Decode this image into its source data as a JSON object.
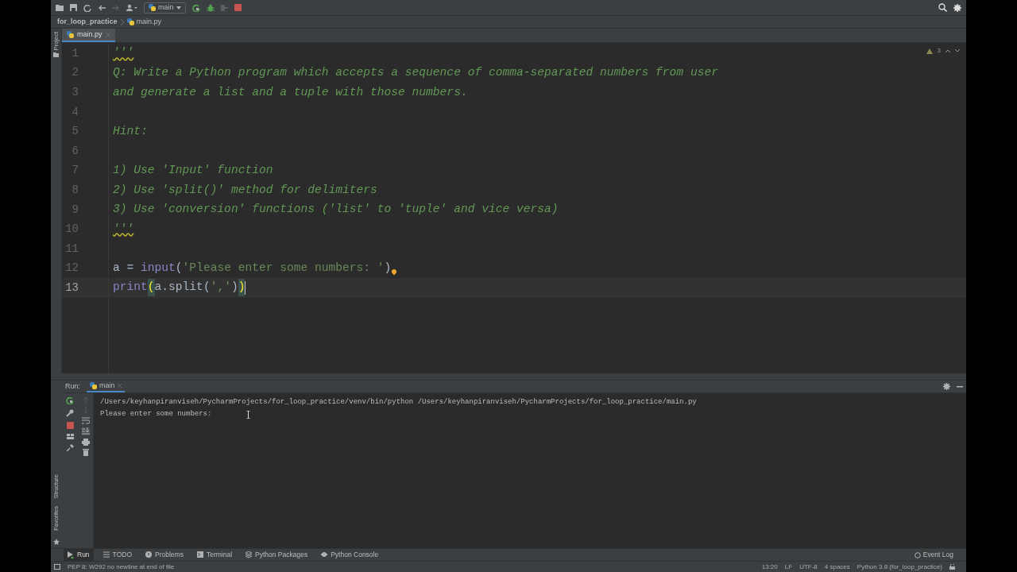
{
  "toolbar": {
    "run_config": "main"
  },
  "breadcrumb": [
    "for_loop_practice",
    "main.py"
  ],
  "left_strip": [
    "Project"
  ],
  "editor_tabs": [
    {
      "label": "main.py",
      "selected": true
    }
  ],
  "editor": {
    "warning_count": "3",
    "lines": [
      {
        "number": "1",
        "current": false,
        "bulb": false,
        "tokens": [
          {
            "text": "'''",
            "kind": "doc_quote"
          }
        ]
      },
      {
        "number": "2",
        "current": false,
        "bulb": false,
        "tokens": [
          {
            "text": "Q: Write a Python program which accepts a sequence of comma-separated numbers from user",
            "kind": "doc"
          }
        ]
      },
      {
        "number": "3",
        "current": false,
        "bulb": false,
        "tokens": [
          {
            "text": "and generate a list and a tuple with those numbers.",
            "kind": "doc"
          }
        ]
      },
      {
        "number": "4",
        "current": false,
        "bulb": false
      },
      {
        "number": "5",
        "current": false,
        "bulb": false,
        "tokens": [
          {
            "text": "Hint:",
            "kind": "doc"
          }
        ]
      },
      {
        "number": "6",
        "current": false,
        "bulb": false
      },
      {
        "number": "7",
        "current": false,
        "bulb": false,
        "tokens": [
          {
            "text": "1) Use 'Input' function",
            "kind": "doc"
          }
        ]
      },
      {
        "number": "8",
        "current": false,
        "bulb": false,
        "tokens": [
          {
            "text": "2) Use 'split()' method for delimiters",
            "kind": "doc"
          }
        ]
      },
      {
        "number": "9",
        "current": false,
        "bulb": false,
        "tokens": [
          {
            "text": "3) Use 'conversion' functions ('list' to 'tuple' and vice versa)",
            "kind": "doc"
          }
        ]
      },
      {
        "number": "10",
        "current": false,
        "bulb": false,
        "tokens": [
          {
            "text": "'''",
            "kind": "doc_quote"
          }
        ]
      },
      {
        "number": "11",
        "current": false,
        "bulb": false
      },
      {
        "number": "12",
        "current": false,
        "bulb": true,
        "tokens": [
          {
            "text": "a",
            "kind": "ident"
          },
          {
            "text": " = ",
            "kind": "ident"
          },
          {
            "text": "input",
            "kind": "builtin"
          },
          {
            "text": "(",
            "kind": "punct"
          },
          {
            "text": "'Please enter some numbers: '",
            "kind": "string"
          },
          {
            "text": ")",
            "kind": "punct"
          }
        ]
      },
      {
        "number": "13",
        "current": true,
        "bulb": false,
        "tokens": [
          {
            "text": "print",
            "kind": "builtin"
          },
          {
            "text": "(",
            "kind": "brace_match"
          },
          {
            "text": "a.split",
            "kind": "ident"
          },
          {
            "text": "(",
            "kind": "punct"
          },
          {
            "text": "','",
            "kind": "string"
          },
          {
            "text": ")",
            "kind": "punct"
          },
          {
            "text": ")",
            "kind": "brace_match"
          }
        ]
      }
    ]
  },
  "run_panel": {
    "label": "Run:",
    "tab": "main",
    "output": [
      "/Users/keyhanpiranviseh/PycharmProjects/for_loop_practice/venv/bin/python /Users/keyhanpiranviseh/PycharmProjects/for_loop_practice/main.py",
      "Please enter some numbers:"
    ]
  },
  "side_labels": [
    "Structure",
    "Favorites"
  ],
  "tool_tabs": [
    {
      "label": "Run",
      "selected": true
    },
    {
      "label": "TODO",
      "selected": false
    },
    {
      "label": "Problems",
      "selected": false
    },
    {
      "label": "Terminal",
      "selected": false
    },
    {
      "label": "Python Packages",
      "selected": false
    },
    {
      "label": "Python Console",
      "selected": false
    }
  ],
  "event_log": "Event Log",
  "status": {
    "message": "PEP 8: W292 no newline at end of file",
    "items": [
      "13:20",
      "LF",
      "UTF-8",
      "4 spaces",
      "Python 3.8 (for_loop_practice)"
    ]
  }
}
